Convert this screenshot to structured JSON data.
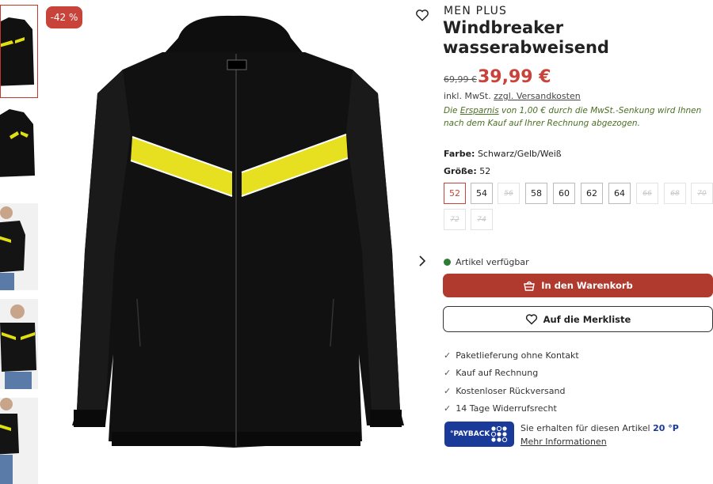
{
  "discount_badge": "-42 %",
  "brand": "MEN PLUS",
  "title_line1": "Windbreaker",
  "title_line2": "wasserabweisend",
  "old_price": "69,99 €",
  "price": "39,99 €",
  "vat_prefix": "inkl. MwSt.",
  "shipping_link": "zzgl. Versandkosten",
  "saving_part1": "Die",
  "saving_link": "Ersparnis",
  "saving_part2": "von 1,00 € durch die MwSt.-Senkung wird Ihnen nach dem Kauf auf Ihrer Rechnung abgezogen.",
  "color_label": "Farbe:",
  "color_value": "Schwarz/Gelb/Weiß",
  "size_label": "Größe:",
  "size_value": "52",
  "sizes": [
    {
      "label": "52",
      "state": "selected"
    },
    {
      "label": "54",
      "state": "available"
    },
    {
      "label": "56",
      "state": "unavailable"
    },
    {
      "label": "58",
      "state": "available"
    },
    {
      "label": "60",
      "state": "available"
    },
    {
      "label": "62",
      "state": "available"
    },
    {
      "label": "64",
      "state": "available"
    },
    {
      "label": "66",
      "state": "unavailable"
    },
    {
      "label": "68",
      "state": "unavailable"
    },
    {
      "label": "70",
      "state": "unavailable"
    },
    {
      "label": "72",
      "state": "unavailable"
    },
    {
      "label": "74",
      "state": "unavailable"
    }
  ],
  "availability": "Artikel verfügbar",
  "availability_color": "#2e7d32",
  "cart_button": "In den Warenkorb",
  "wishlist_button": "Auf die Merkliste",
  "benefits": [
    "Paketlieferung ohne Kontakt",
    "Kauf auf Rechnung",
    "Kostenloser Rückversand",
    "14 Tage Widerrufsrecht"
  ],
  "payback_logo_text": "°PAYBACK",
  "payback_text": "Sie erhalten für diesen Artikel",
  "payback_points": "20 °P",
  "payback_more": "Mehr Informationen",
  "colors": {
    "accent": "#c8433a",
    "cart_button": "#b03a2e",
    "payback": "#1a3a9a",
    "saving_text": "#4a7020"
  },
  "icons": [
    "heart-icon",
    "chevron-right-icon",
    "basket-icon",
    "check-icon",
    "payback-logo"
  ]
}
